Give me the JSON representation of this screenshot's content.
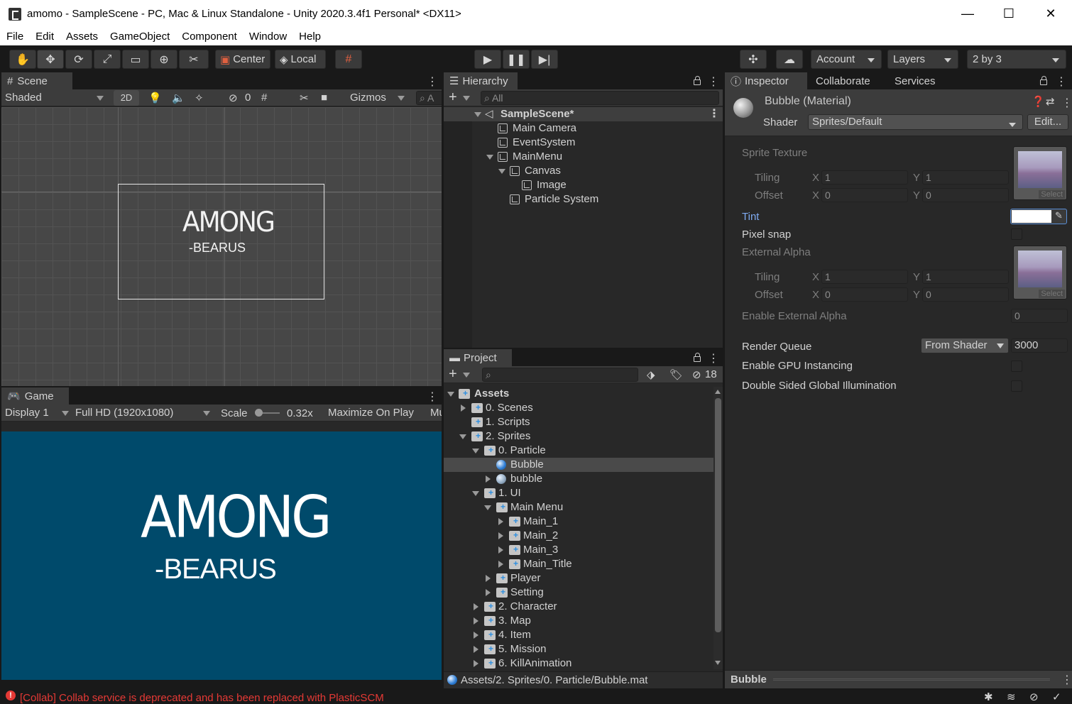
{
  "window": {
    "title": "amomo - SampleScene - PC, Mac & Linux Standalone - Unity 2020.3.4f1 Personal* <DX11>",
    "minimize": "—",
    "maximize": "☐",
    "close": "✕"
  },
  "menu": [
    "File",
    "Edit",
    "Assets",
    "GameObject",
    "Component",
    "Window",
    "Help"
  ],
  "toolbar": {
    "pivot": "Center",
    "space": "Local",
    "account": "Account",
    "layers": "Layers",
    "layout": "2 by 3"
  },
  "scene": {
    "tab": "Scene",
    "shading": "Shaded",
    "mode2d": "2D",
    "hidden_count": "0",
    "gizmos": "Gizmos",
    "search_prefix": "A",
    "logo_line1": "AMONG",
    "logo_line2": "-BEARUS"
  },
  "game": {
    "tab": "Game",
    "display": "Display 1",
    "resolution": "Full HD (1920x1080)",
    "scale_label": "Scale",
    "scale_value": "0.32x",
    "maximize": "Maximize On Play",
    "mute": "Mu",
    "logo_line1": "AMONG",
    "logo_line2": "-BEARUS",
    "bg_color": "#004a6b"
  },
  "hierarchy": {
    "tab": "Hierarchy",
    "search_placeholder": "All",
    "items": [
      {
        "label": "SampleScene*"
      },
      {
        "label": "Main Camera"
      },
      {
        "label": "EventSystem"
      },
      {
        "label": "MainMenu"
      },
      {
        "label": "Canvas"
      },
      {
        "label": "Image"
      },
      {
        "label": "Particle System"
      }
    ]
  },
  "project": {
    "tab": "Project",
    "hidden_count": "18",
    "path": "Assets/2. Sprites/0. Particle/Bubble.mat",
    "items": [
      {
        "label": "Assets"
      },
      {
        "label": "0. Scenes"
      },
      {
        "label": "1. Scripts"
      },
      {
        "label": "2. Sprites"
      },
      {
        "label": "0. Particle"
      },
      {
        "label": "Bubble"
      },
      {
        "label": "bubble"
      },
      {
        "label": "1. UI"
      },
      {
        "label": "Main Menu"
      },
      {
        "label": "Main_1"
      },
      {
        "label": "Main_2"
      },
      {
        "label": "Main_3"
      },
      {
        "label": "Main_Title"
      },
      {
        "label": "Player"
      },
      {
        "label": "Setting"
      },
      {
        "label": "2. Character"
      },
      {
        "label": "3. Map"
      },
      {
        "label": "4. Item"
      },
      {
        "label": "5. Mission"
      },
      {
        "label": "6. KillAnimation"
      }
    ]
  },
  "inspector": {
    "tabs": [
      "Inspector",
      "Collaborate",
      "Services"
    ],
    "material_name": "Bubble (Material)",
    "shader_label": "Shader",
    "shader_value": "Sprites/Default",
    "edit_button": "Edit...",
    "sprite_texture": "Sprite Texture",
    "tiling": "Tiling",
    "offset": "Offset",
    "x": "X",
    "y": "Y",
    "tiling_x": "1",
    "tiling_y": "1",
    "offset_x": "0",
    "offset_y": "0",
    "tint": "Tint",
    "pixel_snap": "Pixel snap",
    "external_alpha": "External Alpha",
    "ext_tiling_x": "1",
    "ext_tiling_y": "1",
    "ext_offset_x": "0",
    "ext_offset_y": "0",
    "enable_external_alpha": "Enable External Alpha",
    "enable_external_alpha_value": "0",
    "render_queue": "Render Queue",
    "render_queue_mode": "From Shader",
    "render_queue_value": "3000",
    "gpu_instancing": "Enable GPU Instancing",
    "double_sided_gi": "Double Sided Global Illumination",
    "select": "Select",
    "preview_title": "Bubble"
  },
  "status": {
    "message": "[Collab] Collab service is deprecated and has been replaced with PlasticSCM",
    "error_color": "#e53935"
  }
}
